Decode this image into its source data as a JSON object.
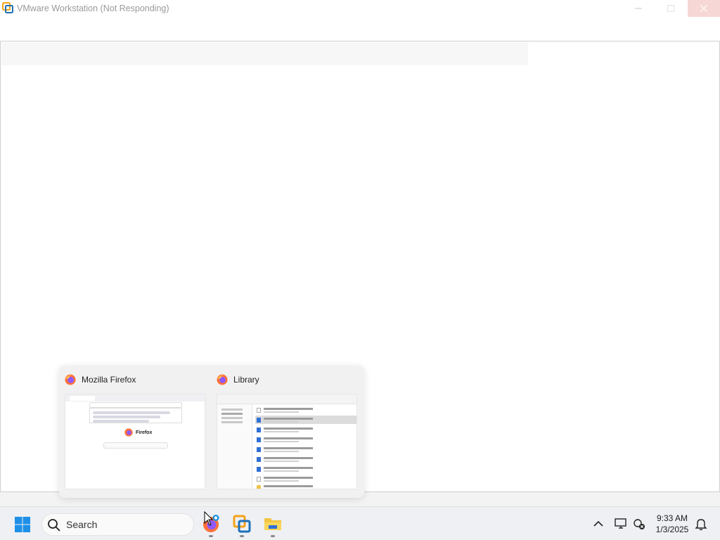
{
  "window": {
    "title": "VMware Workstation (Not Responding)",
    "buttons": {
      "minimize": "minimize",
      "maximize": "maximize",
      "close": "close"
    }
  },
  "previews": [
    {
      "title": "Mozilla Firefox",
      "icon": "firefox-icon",
      "thumbnail": {
        "logo_text": "Firefox"
      }
    },
    {
      "title": "Library",
      "icon": "firefox-icon"
    }
  ],
  "taskbar": {
    "search_label": "Search",
    "apps": [
      {
        "name": "Mozilla Firefox",
        "icon": "firefox-icon",
        "active": true
      },
      {
        "name": "VMware Workstation",
        "icon": "vmware-icon",
        "active": true
      },
      {
        "name": "File Explorer",
        "icon": "folder-icon",
        "active": true
      }
    ],
    "tray": {
      "time": "9:33 AM",
      "date": "1/3/2025"
    }
  },
  "colors": {
    "accent": "#0078d4",
    "close_hover": "#f7d6d6",
    "taskbar_bg": "#eef0f3"
  }
}
